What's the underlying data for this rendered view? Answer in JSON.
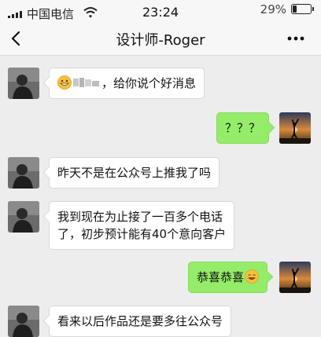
{
  "status_bar": {
    "carrier": "中国电信",
    "time": "23:24",
    "battery_percent": "29%",
    "icons": [
      "signal-icon",
      "wifi-icon",
      "battery-icon"
    ]
  },
  "nav": {
    "title": "设计师-Roger",
    "back_icon": "chevron-left-icon",
    "more_icon": "more-icon"
  },
  "messages": [
    {
      "side": "left",
      "text": "，给你说个好消息",
      "emoji_before": "grin-emoji-icon",
      "redacted_name": true
    },
    {
      "side": "right",
      "text": "？？？"
    },
    {
      "side": "left",
      "text": "昨天不是在公众号上推我了吗"
    },
    {
      "side": "left",
      "lines": [
        "我到现在为止接了一百多个电话",
        "了，初步预计能有40个意向客户"
      ]
    },
    {
      "side": "right",
      "text": "恭喜恭喜",
      "emoji_after": "smile-emoji-icon"
    },
    {
      "side": "left",
      "text": "看来以后作品还是要多往公众号"
    }
  ],
  "colors": {
    "chat_bg": "#ededed",
    "outgoing_bubble": "#95ec69",
    "incoming_bubble": "#ffffff"
  }
}
